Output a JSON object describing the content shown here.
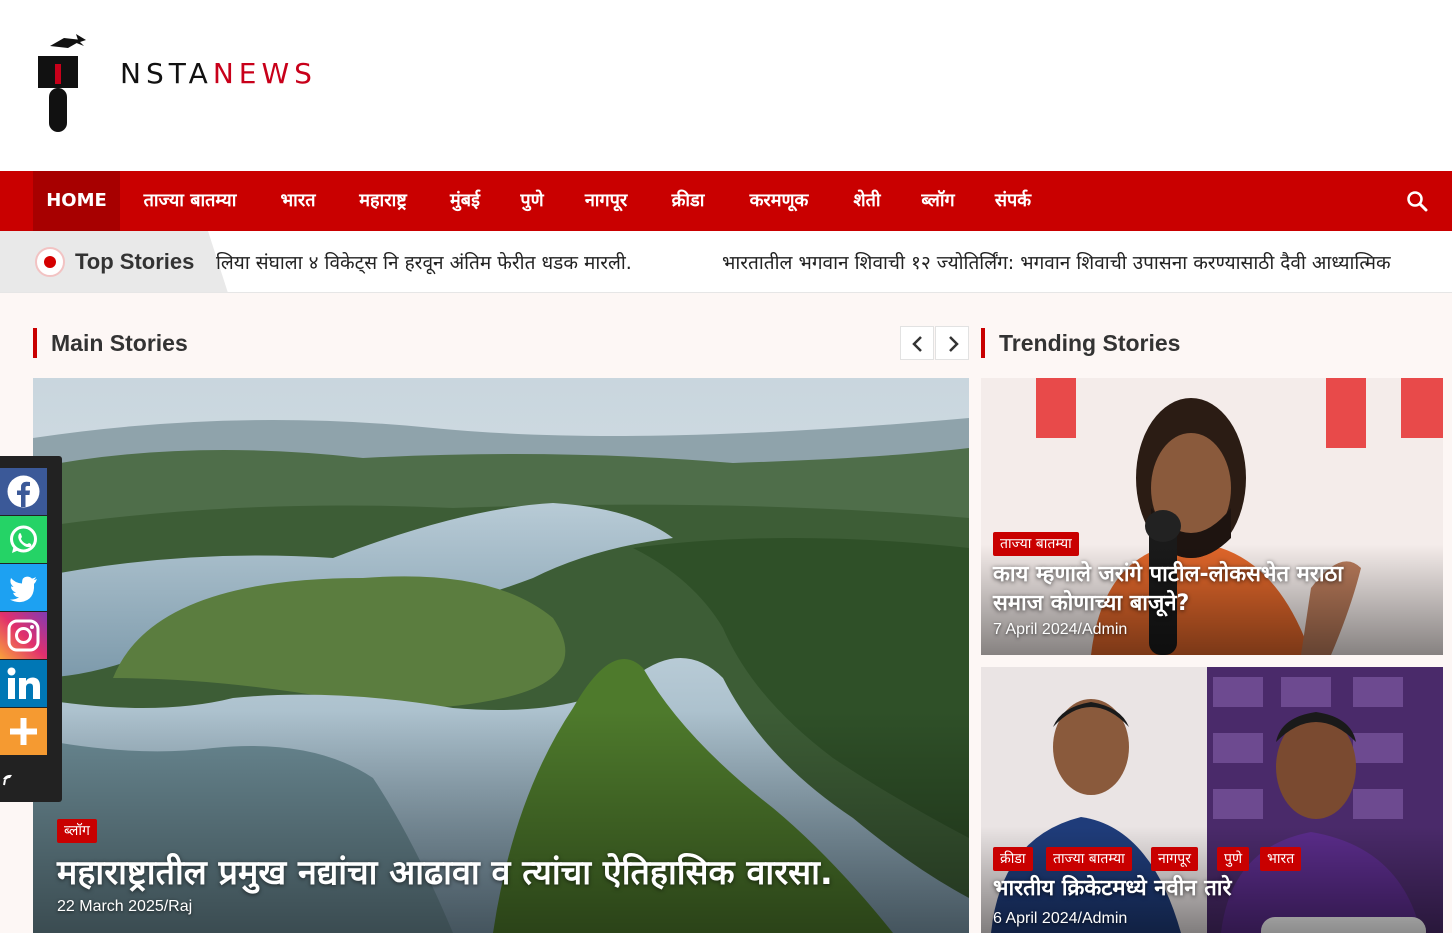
{
  "logo": {
    "first_letter": "I",
    "rest": "NSTA",
    "second": "NEWS"
  },
  "nav": {
    "items": [
      {
        "label": "HOME",
        "active": true
      },
      {
        "label": "ताज्या बातम्या"
      },
      {
        "label": "भारत"
      },
      {
        "label": "महाराष्ट्र"
      },
      {
        "label": "मुंबई"
      },
      {
        "label": "पुणे"
      },
      {
        "label": "नागपूर"
      },
      {
        "label": "क्रीडा"
      },
      {
        "label": "करमणूक"
      },
      {
        "label": "शेती"
      },
      {
        "label": "ब्लॉग"
      },
      {
        "label": "संपर्क"
      }
    ],
    "search_icon": "search-icon"
  },
  "ticker": {
    "label": "Top Stories",
    "items": [
      "लिया संघाला ४ विकेट्स नि हरवून अंतिम फेरीत धडक मारली.",
      "भारतातील भगवान शिवाची १२ ज्योतिर्लिंग: भगवान शिवाची उपासना करण्यासाठी दैवी आध्यात्मिक"
    ]
  },
  "main_stories": {
    "title": "Main Stories",
    "hero": {
      "category": "ब्लॉग",
      "title": "महाराष्ट्रातील प्रमुख नद्यांचा आढावा व त्यांचा ऐतिहासिक वारसा.",
      "meta": "22 March 2025/Raj"
    }
  },
  "trending": {
    "title": "Trending Stories",
    "cards": [
      {
        "categories": [
          "ताज्या बातम्या"
        ],
        "title_line1": "काय म्हणाले जरांगे पाटील-लोकसभेत मराठा",
        "title_line2": "समाज कोणाच्या बाजूने?",
        "meta": "7 April 2024/Admin"
      },
      {
        "categories": [
          "क्रीडा",
          "ताज्या बातम्या",
          "नागपूर",
          "पुणे",
          "भारत"
        ],
        "title_line1": "भारतीय क्रिकेटमध्ये नवीन तारे",
        "meta": "6 April 2024/Admin"
      }
    ]
  },
  "social": [
    "facebook-icon",
    "whatsapp-icon",
    "twitter-icon",
    "instagram-icon",
    "linkedin-icon",
    "more-icon"
  ],
  "colors": {
    "brand_red": "#c90000",
    "nav_active": "#a70000",
    "page_bg": "#fdf7f5"
  }
}
